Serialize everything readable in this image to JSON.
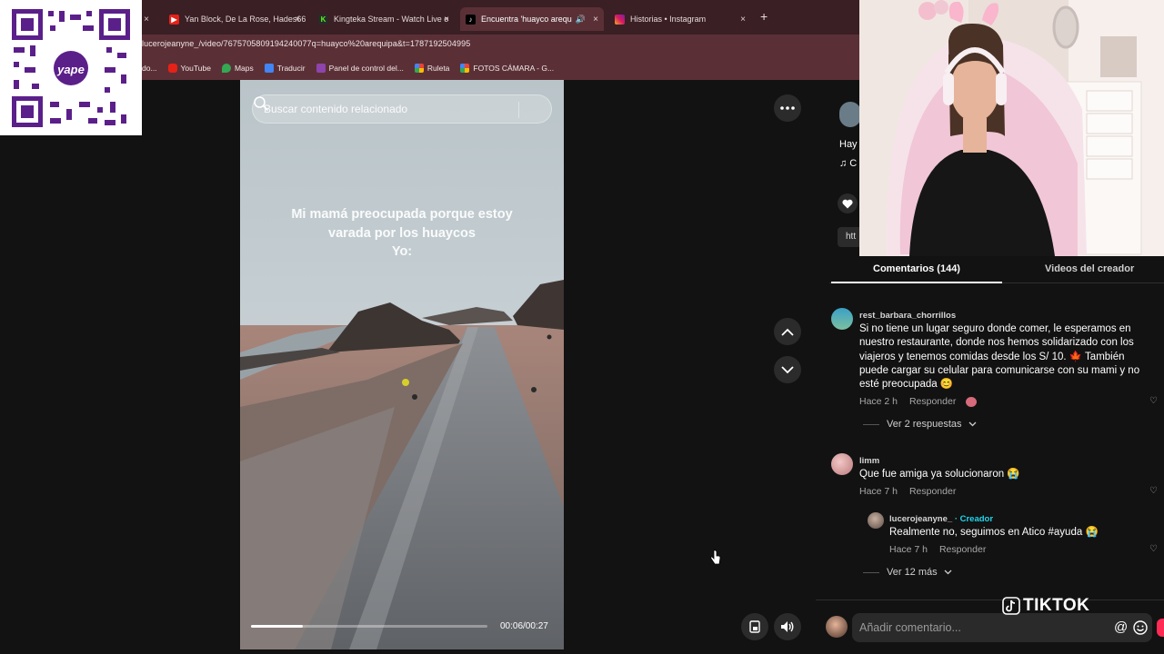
{
  "browser": {
    "tabs": [
      {
        "title": "Yan Block, De La Rose, Hades66",
        "icon": "youtube-icon"
      },
      {
        "title": "Kingteka Stream - Watch Live o",
        "icon": "kick-icon"
      },
      {
        "title": "Encuentra 'huayco arequipa",
        "icon": "tiktok-icon",
        "active": true
      },
      {
        "title": "Historias • Instagram",
        "icon": "instagram-icon"
      }
    ],
    "close_glyph": "×",
    "new_tab_glyph": "+",
    "url": "lucerojeanyne_/video/7675705809194240077q=huayco%20arequipa&t=1787192504995",
    "bookmarks": [
      {
        "label": "do..."
      },
      {
        "label": "YouTube"
      },
      {
        "label": "Maps"
      },
      {
        "label": "Traducir"
      },
      {
        "label": "Panel de control del..."
      },
      {
        "label": "Ruleta"
      },
      {
        "label": "FOTOS CÁMARA - G..."
      }
    ]
  },
  "qr": {
    "brand": "yape"
  },
  "video": {
    "search_placeholder": "Buscar contenido relacionado",
    "caption": "Mi mamá preocupada porque estoy\nvarada por los huaycos\nYo:",
    "progress": 0.22,
    "time": "00:06/00:27"
  },
  "sidebar": {
    "peek_title": "Hay",
    "peek_music": "♫ C",
    "peek_link": "htt",
    "tabs": {
      "comments": "Comentarios (144)",
      "creator_videos": "Videos del creador"
    },
    "comments": [
      {
        "user": "rest_barbara_chorrillos",
        "text": "Si no tiene un lugar seguro donde comer, le esperamos en nuestro restaurante, donde nos hemos solidarizado con los viajeros y tenemos comidas desde los S/ 10. 🍁 También puede cargar su celular para comunicarse con su mami y no esté preocupada 😊",
        "time": "Hace 2 h",
        "reply": "Responder",
        "more": "Ver 2 respuestas"
      },
      {
        "user": "limm",
        "text": "Que fue amiga ya solucionaron 😭",
        "time": "Hace 7 h",
        "reply": "Responder"
      },
      {
        "user": "lucerojeanyne_",
        "creator_tag": "· Creador",
        "text": "Realmente no, seguimos en Atico #ayuda 😭",
        "time": "Hace 7 h",
        "reply": "Responder",
        "more": "Ver 12 más"
      }
    ],
    "comment_placeholder": "Añadir comentario...",
    "at_glyph": "@"
  },
  "watermark": "TIKTOK",
  "colors": {
    "accent": "#fe2c55",
    "creator": "#20d5ec",
    "tab_bar": "#3a1f24",
    "toolbar": "#5a3036"
  }
}
